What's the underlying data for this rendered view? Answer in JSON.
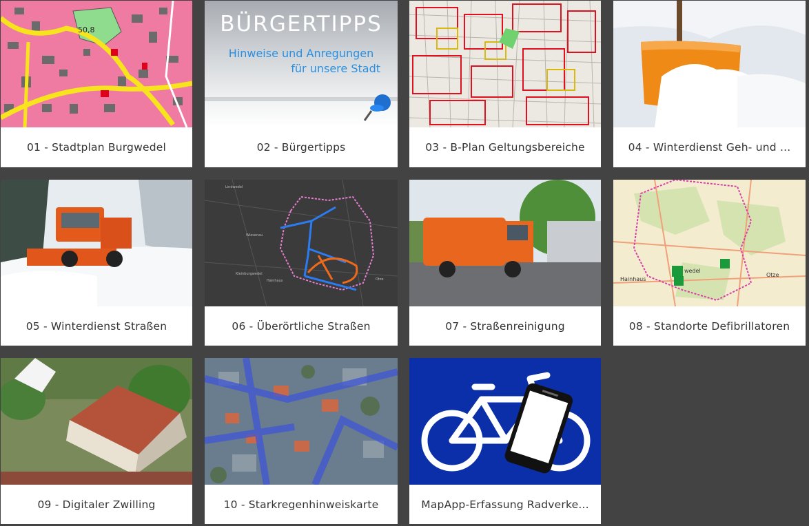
{
  "tiles": [
    {
      "label": "01 - Stadtplan Burgwedel",
      "thumb_text": "50,8",
      "thumb_icon": "city-map-thumbnail"
    },
    {
      "label": "02 - Bürgertipps",
      "thumb_title": "BÜRGERTIPPS",
      "thumb_line1": "Hinweise und Anregungen",
      "thumb_line2": "für unsere  Stadt",
      "thumb_icon": "pushpin-icon"
    },
    {
      "label": "03 - B-Plan Geltungsbereiche",
      "thumb_icon": "zoning-map-thumbnail"
    },
    {
      "label": "04 - Winterdienst Geh- und ...",
      "thumb_icon": "snow-shovel-thumbnail"
    },
    {
      "label": "05 - Winterdienst Straßen",
      "thumb_icon": "snowplow-truck-thumbnail"
    },
    {
      "label": "06 - Überörtliche Straßen",
      "thumb_icon": "road-network-map-thumbnail",
      "thumb_places": [
        "Lindwedel",
        "Wiesenau",
        "Kleinburgwedel",
        "Hainhaus",
        "Otze"
      ]
    },
    {
      "label": "07 - Straßenreinigung",
      "thumb_icon": "street-sweeper-thumbnail"
    },
    {
      "label": "08 - Standorte Defibrillatoren",
      "thumb_icon": "defibrillator-map-thumbnail",
      "thumb_places": [
        "wedel",
        "Hainhaus",
        "Otze"
      ]
    },
    {
      "label": "09 - Digitaler Zwilling",
      "thumb_icon": "digital-twin-house-thumbnail"
    },
    {
      "label": "10 - Starkregenhinweiskarte",
      "thumb_icon": "heavy-rain-aerial-thumbnail"
    },
    {
      "label": "MapApp-Erfassung Radverke...",
      "thumb_icon": "bicycle-phone-icon"
    }
  ],
  "colors": {
    "background": "#434343",
    "card": "#ffffff",
    "caption_text": "#333333",
    "bike_sign_blue": "#0b2fa8",
    "map_pink": "#f06fa0"
  }
}
